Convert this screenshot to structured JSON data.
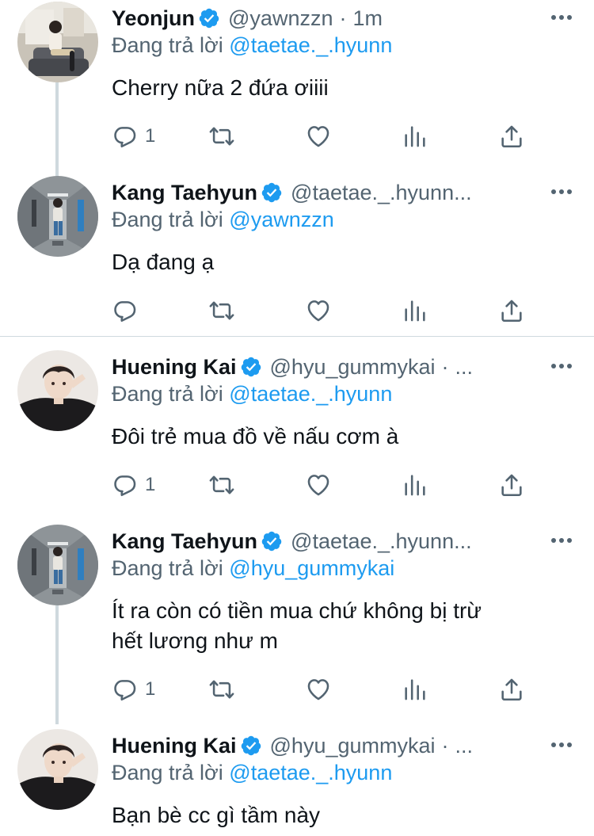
{
  "colors": {
    "link": "#1d9bf0",
    "muted": "#536471",
    "text": "#0f1419",
    "verified": "#1d9bf0"
  },
  "tweets": [
    {
      "name": "Yeonjun",
      "handle": "@yawnzzn",
      "sep": "·",
      "time": "1m",
      "reply_prefix": "Đang trả lời",
      "reply_to": "@taetae._.hyunn",
      "text": [
        "Cherry nữa 2 đứa ơiiii"
      ],
      "reply_count": "1"
    },
    {
      "name": "Kang Taehyun",
      "handle": "@taetae._.hyunn...",
      "sep": "",
      "time": "",
      "reply_prefix": "Đang trả lời",
      "reply_to": "@yawnzzn",
      "text": [
        "Dạ đang ạ"
      ],
      "reply_count": ""
    },
    {
      "name": "Huening Kai",
      "handle": "@hyu_gummykai",
      "sep": "·",
      "time": "...",
      "reply_prefix": "Đang trả lời",
      "reply_to": "@taetae._.hyunn",
      "text": [
        "Đôi trẻ mua đồ về nấu cơm à"
      ],
      "reply_count": "1"
    },
    {
      "name": "Kang Taehyun",
      "handle": "@taetae._.hyunn...",
      "sep": "",
      "time": "",
      "reply_prefix": "Đang trả lời",
      "reply_to": "@hyu_gummykai",
      "text": [
        "Ít ra còn có tiền mua chứ không bị trừ",
        "hết lương như m"
      ],
      "reply_count": "1"
    },
    {
      "name": "Huening Kai",
      "handle": "@hyu_gummykai",
      "sep": "·",
      "time": "...",
      "reply_prefix": "Đang trả lời",
      "reply_to": "@taetae._.hyunn",
      "text": [
        "Bạn bè cc gì tầm này"
      ],
      "reply_count": ""
    }
  ]
}
